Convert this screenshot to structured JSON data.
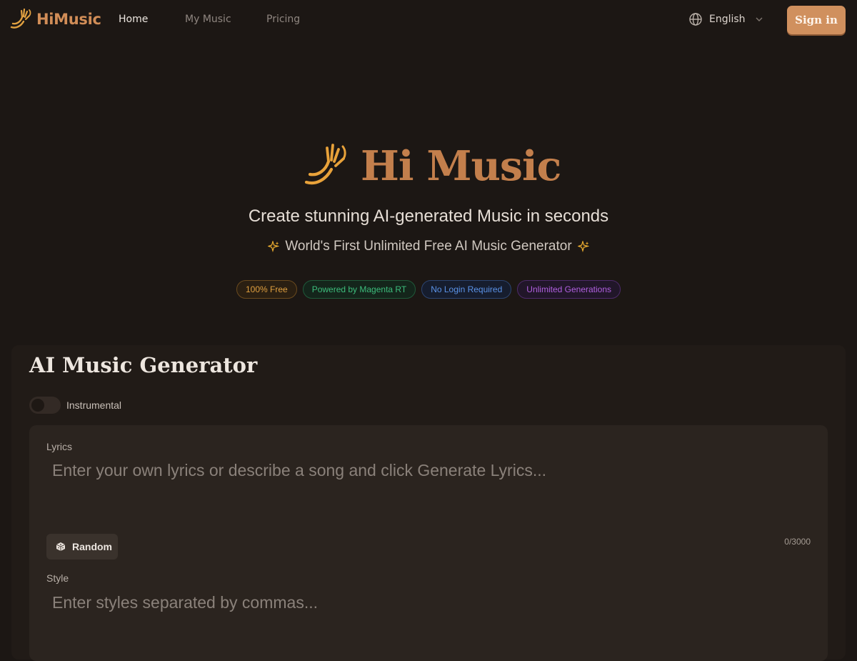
{
  "header": {
    "brand": "HiMusic",
    "nav": [
      {
        "label": "Home",
        "active": true
      },
      {
        "label": "My Music",
        "active": false
      },
      {
        "label": "Pricing",
        "active": false
      }
    ],
    "language": "English",
    "signin_label": "Sign in",
    "icons": [
      "hand-wave-icon",
      "globe-icon",
      "chevron-down-icon"
    ]
  },
  "hero": {
    "title": "Hi Music",
    "subtitle": "Create stunning AI-generated Music in seconds",
    "tagline": "World's First Unlimited Free AI Music Generator",
    "tagline_icon": "sparkles-icon",
    "badges": [
      {
        "label": "100% Free",
        "color": "#e0a040"
      },
      {
        "label": "Powered by Magenta RT",
        "color": "#3dbd7c"
      },
      {
        "label": "No Login Required",
        "color": "#5b93e8"
      },
      {
        "label": "Unlimited Generations",
        "color": "#b160e0"
      }
    ]
  },
  "generator": {
    "title": "AI Music Generator",
    "instrumental_label": "Instrumental",
    "instrumental_on": false,
    "lyrics_label": "Lyrics",
    "lyrics_value": "",
    "lyrics_placeholder": "Enter your own lyrics or describe a song and click Generate Lyrics...",
    "random_label": "Random",
    "random_icon": "dice-icon",
    "char_counter": "0/3000",
    "style_label": "Style",
    "style_value": "",
    "style_placeholder": "Enter styles separated by commas..."
  },
  "colors": {
    "accent": "#d0905e",
    "brand_text": "#c37f4c",
    "background": "#1c1714"
  }
}
